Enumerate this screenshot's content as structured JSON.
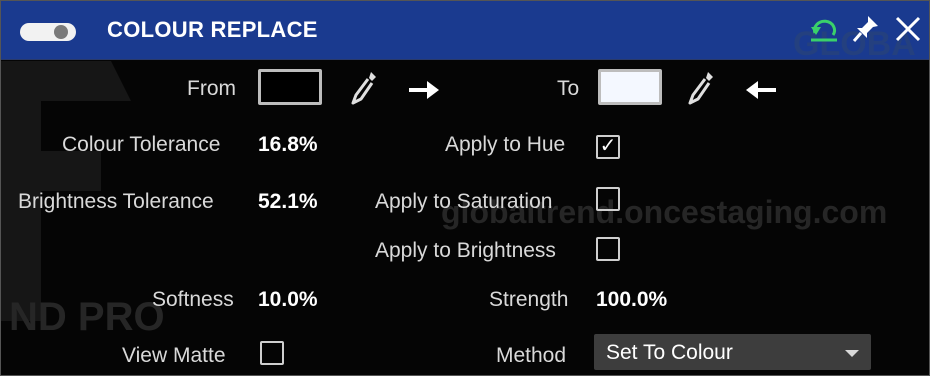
{
  "titlebar": {
    "title": "COLOUR REPLACE",
    "toggle_state": "on",
    "icons": [
      "reset-icon",
      "pin-icon",
      "close-icon"
    ],
    "colors": {
      "background": "#1a3a8f",
      "reset_icon": "#3ad16a"
    }
  },
  "watermark": {
    "top_right": "GLOBA",
    "middle": "globaltrend.oncestaging.com",
    "bottom_left": "ND PRO"
  },
  "colour_row": {
    "from_label": "From",
    "from_color": "#000000",
    "to_label": "To",
    "to_color": "#f4f8ff"
  },
  "params": {
    "colour_tolerance_label": "Colour Tolerance",
    "colour_tolerance_value": "16.8%",
    "brightness_tolerance_label": "Brightness Tolerance",
    "brightness_tolerance_value": "52.1%",
    "softness_label": "Softness",
    "softness_value": "10.0%",
    "view_matte_label": "View Matte",
    "view_matte_checked": false
  },
  "apply": {
    "hue_label": "Apply to Hue",
    "hue_checked": true,
    "saturation_label": "Apply to Saturation",
    "saturation_checked": false,
    "brightness_label": "Apply to Brightness",
    "brightness_checked": false,
    "check_glyph": "✓"
  },
  "strength": {
    "label": "Strength",
    "value": "100.0%"
  },
  "method": {
    "label": "Method",
    "selected": "Set To Colour"
  }
}
